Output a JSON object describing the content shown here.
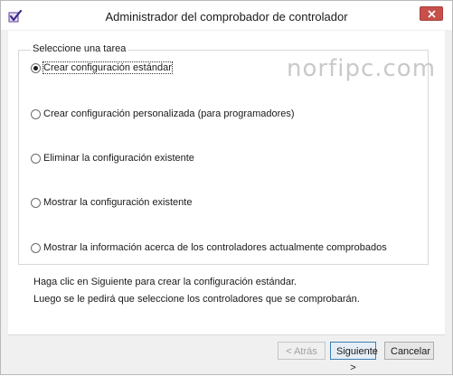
{
  "window": {
    "title": "Administrador del comprobador de controlador",
    "icon": "checkmark-app-icon",
    "watermark": "norfipc.com"
  },
  "task_group": {
    "title": "Seleccione una tarea",
    "options": [
      {
        "label": "Crear configuración estándar",
        "checked": true
      },
      {
        "label": "Crear configuración personalizada (para programadores)",
        "checked": false
      },
      {
        "label": "Eliminar la configuración existente",
        "checked": false
      },
      {
        "label": "Mostrar la configuración existente",
        "checked": false
      },
      {
        "label": "Mostrar la información acerca de los controladores actualmente comprobados",
        "checked": false
      }
    ]
  },
  "description": {
    "line1": "Haga clic en Siguiente para crear la configuración estándar.",
    "line2": "Luego se le pedirá que seleccione los controladores que se comprobarán."
  },
  "buttons": {
    "back": "< Atrás",
    "next": "Siguiente >",
    "cancel": "Cancelar"
  },
  "colors": {
    "close_button": "#c7504b",
    "default_button_border": "#3c7fb1",
    "window_background": "#f0f0f0"
  }
}
